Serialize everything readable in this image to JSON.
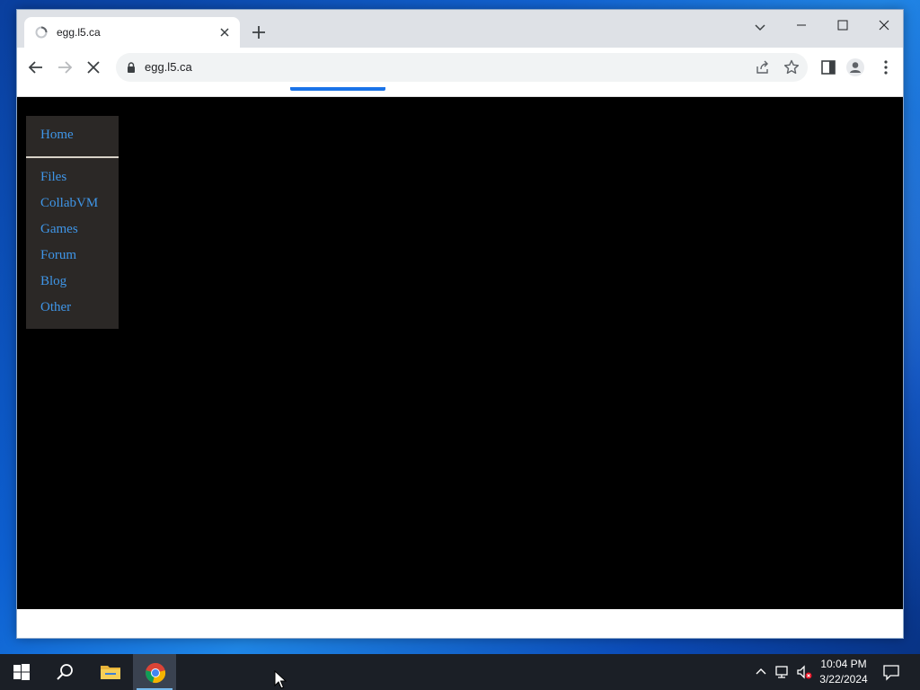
{
  "browser": {
    "tab_title": "egg.l5.ca",
    "url": "egg.l5.ca"
  },
  "sidebar": {
    "items": [
      {
        "label": "Home"
      },
      {
        "label": "Files"
      },
      {
        "label": "CollabVM"
      },
      {
        "label": "Games"
      },
      {
        "label": "Forum"
      },
      {
        "label": "Blog"
      },
      {
        "label": "Other"
      }
    ]
  },
  "taskbar": {
    "time": "10:04 PM",
    "date": "3/22/2024"
  },
  "colors": {
    "link": "#3f96e8",
    "nav_bg": "#2b2826",
    "page_bg": "#000000",
    "loading_bar": "#1a73e8"
  }
}
